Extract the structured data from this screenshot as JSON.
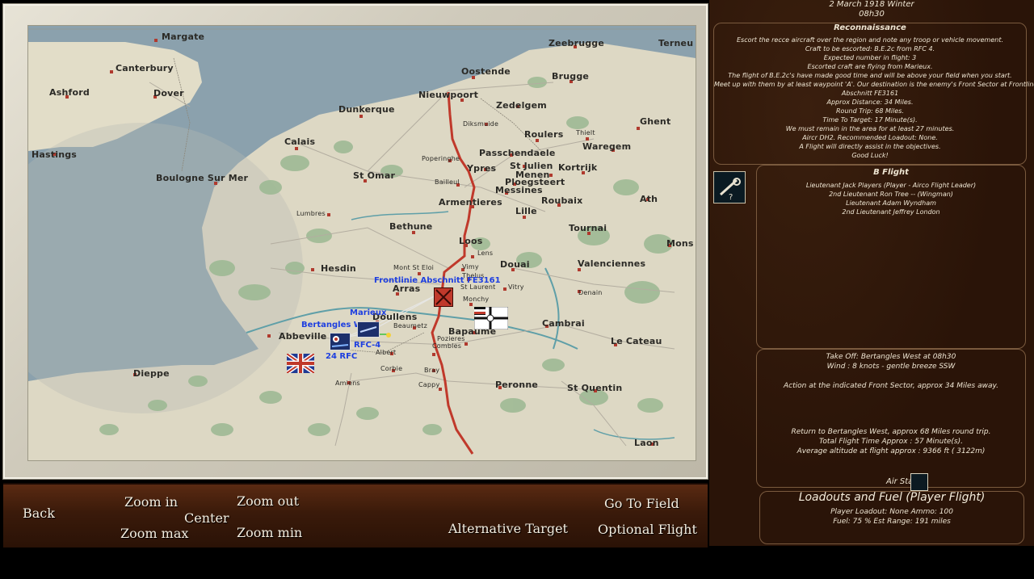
{
  "map": {
    "towns": [
      {
        "id": "margate",
        "name": "Margate"
      },
      {
        "id": "canterbury",
        "name": "Canterbury"
      },
      {
        "id": "ashford",
        "name": "Ashford"
      },
      {
        "id": "dover",
        "name": "Dover"
      },
      {
        "id": "hastings",
        "name": "Hastings"
      },
      {
        "id": "zeebrugge",
        "name": "Zeebrugge"
      },
      {
        "id": "terneu",
        "name": "Terneu"
      },
      {
        "id": "oostende",
        "name": "Oostende"
      },
      {
        "id": "brugge",
        "name": "Brugge"
      },
      {
        "id": "nieuwpoort",
        "name": "Nieuwpoort"
      },
      {
        "id": "zedelgem",
        "name": "Zedelgem"
      },
      {
        "id": "dunkerque",
        "name": "Dunkerque"
      },
      {
        "id": "diksmuide",
        "name": "Diksmuide"
      },
      {
        "id": "roulers",
        "name": "Roulers"
      },
      {
        "id": "thielt",
        "name": "Thielt"
      },
      {
        "id": "ghent",
        "name": "Ghent"
      },
      {
        "id": "calais",
        "name": "Calais"
      },
      {
        "id": "poperinghe",
        "name": "Poperinghe"
      },
      {
        "id": "passchendaele",
        "name": "Passchendaele"
      },
      {
        "id": "waregem",
        "name": "Waregem"
      },
      {
        "id": "ypres",
        "name": "Ypres"
      },
      {
        "id": "stjulien",
        "name": "St Julien"
      },
      {
        "id": "menen",
        "name": "Menen"
      },
      {
        "id": "kortrijk",
        "name": "Kortrijk"
      },
      {
        "id": "boulogne",
        "name": "Boulogne Sur Mer"
      },
      {
        "id": "stomer",
        "name": "St Omar"
      },
      {
        "id": "bailleul",
        "name": "Bailleul"
      },
      {
        "id": "ploegsteert",
        "name": "Ploegsteert"
      },
      {
        "id": "messines",
        "name": "Messines"
      },
      {
        "id": "armentieres",
        "name": "Armentieres"
      },
      {
        "id": "roubaix",
        "name": "Roubaix"
      },
      {
        "id": "ath",
        "name": "Ath"
      },
      {
        "id": "lille",
        "name": "Lille"
      },
      {
        "id": "lumbres",
        "name": "Lumbres"
      },
      {
        "id": "bethune",
        "name": "Bethune"
      },
      {
        "id": "tournai",
        "name": "Tournai"
      },
      {
        "id": "loos",
        "name": "Loos"
      },
      {
        "id": "lens",
        "name": "Lens"
      },
      {
        "id": "mons",
        "name": "Mons"
      },
      {
        "id": "hesdin",
        "name": "Hesdin"
      },
      {
        "id": "montstel",
        "name": "Mont St Eloi"
      },
      {
        "id": "vimy",
        "name": "Vimy"
      },
      {
        "id": "thelus",
        "name": "Thelus"
      },
      {
        "id": "douai",
        "name": "Douai"
      },
      {
        "id": "valenciennes",
        "name": "Valenciennes"
      },
      {
        "id": "arras",
        "name": "Arras"
      },
      {
        "id": "stlaurent",
        "name": "St Laurent"
      },
      {
        "id": "vitry",
        "name": "Vitry"
      },
      {
        "id": "denain",
        "name": "Denain"
      },
      {
        "id": "monchy",
        "name": "Monchy"
      },
      {
        "id": "doullens",
        "name": "Doullens"
      },
      {
        "id": "beaumetz",
        "name": "Beaumetz"
      },
      {
        "id": "bapaume",
        "name": "Bapaume"
      },
      {
        "id": "cambrai",
        "name": "Cambrai"
      },
      {
        "id": "abbeville",
        "name": "Abbeville"
      },
      {
        "id": "albert",
        "name": "Albert"
      },
      {
        "id": "pozieres",
        "name": "Pozieres"
      },
      {
        "id": "combles",
        "name": "Combles"
      },
      {
        "id": "lecateau",
        "name": "Le Cateau"
      },
      {
        "id": "dieppe",
        "name": "Dieppe"
      },
      {
        "id": "corbie",
        "name": "Corbie"
      },
      {
        "id": "bray",
        "name": "Bray"
      },
      {
        "id": "amiens",
        "name": "Amiens"
      },
      {
        "id": "cappy",
        "name": "Cappy"
      },
      {
        "id": "peronne",
        "name": "Peronne"
      },
      {
        "id": "stquentin",
        "name": "St Quentin"
      },
      {
        "id": "laon",
        "name": "Laon"
      }
    ],
    "overlay": {
      "frontline_target": "Frontlinie Abschnitt FE3161",
      "marieux": "Marieux",
      "bertangles": "Bertangles West",
      "rfc4": "RFC-4",
      "rfc24": "24 RFC"
    },
    "flags": {
      "british": "Union Jack",
      "german": "German Imperial Ensign"
    }
  },
  "controls": {
    "back": "Back",
    "zoom_in": "Zoom in",
    "center": "Center",
    "zoom_max": "Zoom max",
    "zoom_out": "Zoom out",
    "zoom_min": "Zoom min",
    "alt_target": "Alternative Target",
    "go_to_field": "Go To Field",
    "optional_flight": "Optional Flight"
  },
  "briefing": {
    "date": "2 March 1918 Winter",
    "time": "08h30",
    "mission_title": "Reconnaissance",
    "lines": [
      "Escort the recce aircraft over the region and note any troop or vehicle movement.",
      "Craft to be escorted: B.E.2c from RFC 4.",
      "Expected number in flight: 3",
      "Escorted craft are flying from Marieux.",
      "The flight of B.E.2c's have made good time and will be above your field when you start.",
      "Meet up with them by at least waypoint 'A'. Our destination is the enemy's Front Sector at Frontline",
      "Abschnitt FE3161",
      "Approx Distance: 34 Miles.",
      "Round Trip: 68 Miles.",
      "Time To Target: 17 Minute(s).",
      "We must remain in the area for at least 27 minutes.",
      "Aircr DH2. Recommended Loadout: None.",
      "A Flight will directly assist in the objectives.",
      "Good Luck!"
    ]
  },
  "flight": {
    "title": "B Flight",
    "pilots": [
      "Lieutenant Jack Players (Player - Airco Flight Leader)",
      "2nd Lieutenant Ron Tree -- (Wingman)",
      "Lieutenant Adam Wyndham",
      "2nd Lieutenant Jeffrey London"
    ],
    "icon": "recon-aircraft-icon"
  },
  "takeoff": {
    "takeoff": "Take Off: Bertangles West at 08h30",
    "wind": "Wind : 8 knots -  gentle breeze SSW",
    "action": "Action at the indicated Front Sector, approx 34 Miles away.",
    "return": "Return to Bertangles West, approx 68 Miles round trip.",
    "total_time": "Total Flight Time Approx : 57 Minute(s).",
    "altitude": "Average altitude at flight approx : 9366 ft  ( 3122m)",
    "air_start_label": "Air Start:"
  },
  "loadouts": {
    "title": "Loadouts and Fuel (Player Flight)",
    "line1": "Player Loadout: None   Ammo: 100",
    "line2": "Fuel: 75 %     Est Range: 191 miles"
  },
  "colors": {
    "sea": "#7d96a6",
    "land": "#ddd8c4",
    "frontline": "#c0392b",
    "overlay_text": "#1e3fe0",
    "panel_bg": "#2a1408"
  }
}
